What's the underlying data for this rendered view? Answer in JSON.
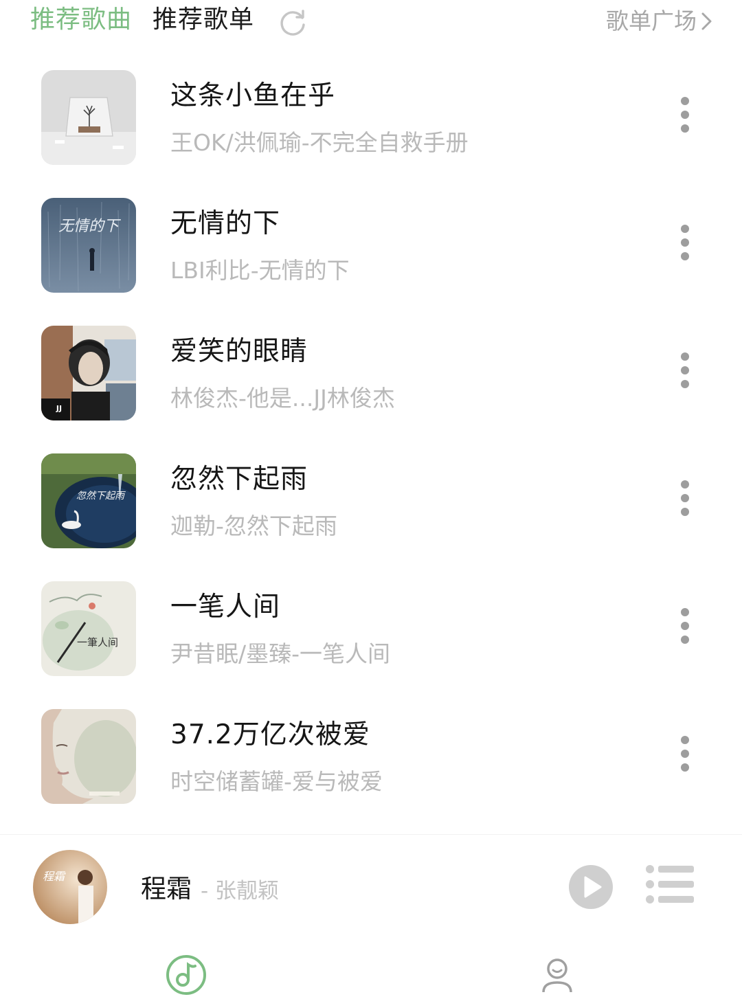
{
  "tabs": {
    "recommended_songs": "推荐歌曲",
    "recommended_playlists": "推荐歌单",
    "playlist_plaza": "歌单广场"
  },
  "songs": [
    {
      "title": "这条小鱼在乎",
      "subtitle": "王OK/洪佩瑜-不完全自救手册"
    },
    {
      "title": "无情的下",
      "subtitle": "LBI利比-无情的下",
      "cover_text": "无情的下"
    },
    {
      "title": "爱笑的眼睛",
      "subtitle": "林俊杰-他是...JJ林俊杰",
      "cover_text": "JJ"
    },
    {
      "title": "忽然下起雨",
      "subtitle": "迦勒-忽然下起雨",
      "cover_text": "忽然下起雨"
    },
    {
      "title": "一笔人间",
      "subtitle": "尹昔眠/墨臻-一笔人间",
      "cover_text": "一筆人间"
    },
    {
      "title": "37.2万亿次被爱",
      "subtitle": "时空储蓄罐-爱与被爱"
    }
  ],
  "player": {
    "title": "程霜",
    "artist": "- 张靓颖",
    "cover_text": "程霜"
  },
  "colors": {
    "accent": "#7cbd82",
    "title_text": "#161616",
    "secondary_text": "#b9b9b9",
    "icon_gray": "#cfcfcf"
  },
  "icons": {
    "refresh": "refresh-icon",
    "chevron": "chevron-right-icon",
    "more": "more-vertical-icon",
    "play": "play-icon",
    "queue": "playlist-icon",
    "nav_music": "music-note-icon",
    "nav_user": "user-icon"
  }
}
